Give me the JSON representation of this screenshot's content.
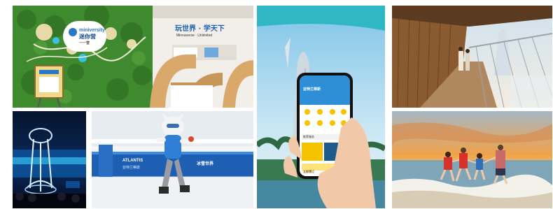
{
  "gallery": {
    "miniversity": {
      "brand_name": "miniversity",
      "brand_cn": "迷你营",
      "brand_sub": "一一营",
      "slogan_cn": "玩世界 · 学天下",
      "slogan_en": "Minnaverse · Unlimited"
    },
    "rink": {
      "banner_left": "ATLANTIS",
      "banner_sub": "亚特兰蒂斯",
      "banner_cn": "冰雪世界"
    },
    "app": {
      "header": "亚特兰蒂斯",
      "section": "推荐服务",
      "button": "立即预订"
    },
    "colors": {
      "accent_blue": "#1e5fb4",
      "app_yellow": "#f5c400",
      "lawn_green": "#3f8a2e",
      "sunset_orange": "#f0a24a"
    }
  }
}
